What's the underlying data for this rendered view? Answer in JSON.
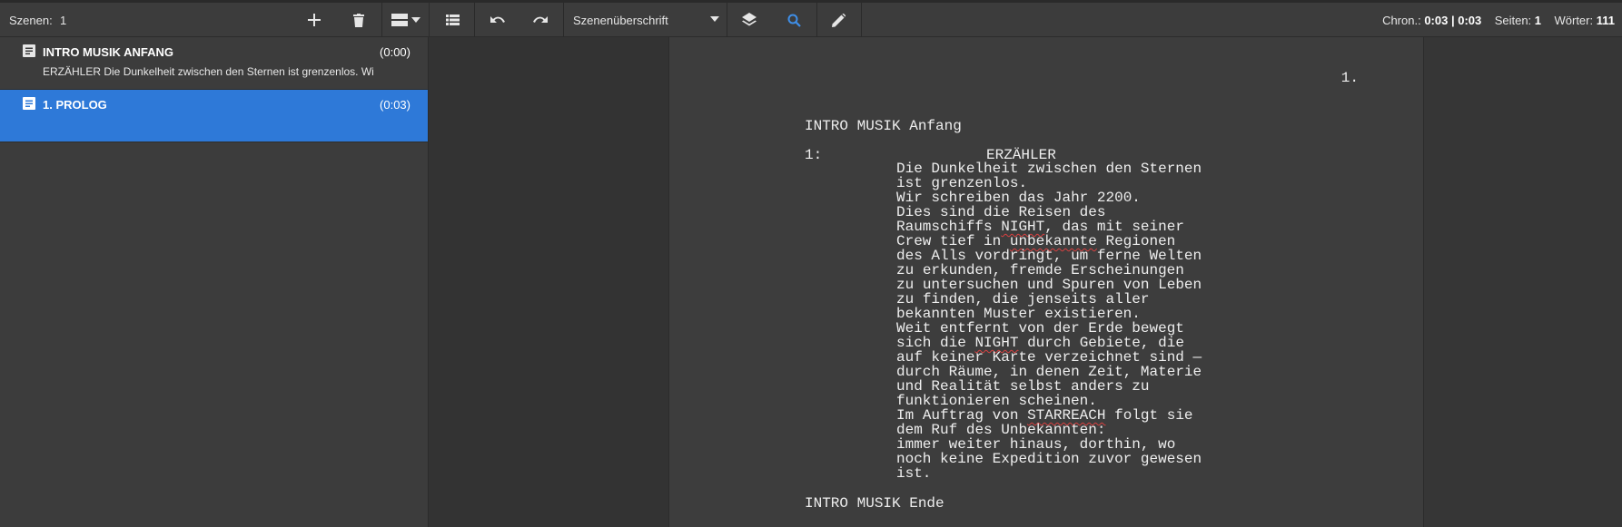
{
  "toolbar": {
    "scenes_label": "Szenen:",
    "scenes_count": "1",
    "add_icon": "plus-icon",
    "delete_icon": "trash-icon",
    "view_icon": "view-split-icon",
    "list_icon": "list-icon",
    "undo_icon": "undo-icon",
    "redo_icon": "redo-icon",
    "element_type": "Szenenüberschrift",
    "layers_icon": "layers-icon",
    "search_icon": "search-icon",
    "edit_icon": "pencil-icon",
    "stats": {
      "chron_label": "Chron.:",
      "chron_value": "0:03 | 0:03",
      "pages_label": "Seiten:",
      "pages_value": "1",
      "words_label": "Wörter:",
      "words_value": "111"
    }
  },
  "sidebar": {
    "scenes": [
      {
        "title": "INTRO MUSIK ANFANG",
        "time": "(0:00)",
        "description": "ERZÄHLER Die Dunkelheit zwischen den Sternen ist grenzenlos. Wir",
        "selected": false
      },
      {
        "title": "1. PROLOG",
        "time": "(0:03)",
        "description": "",
        "selected": true
      }
    ]
  },
  "script_page": {
    "page_number": "1.",
    "heading": "INTRO MUSIK Anfang",
    "line_number": "1:",
    "speaker": "ERZÄHLER",
    "dialog_lines": [
      "Die Dunkelheit zwischen den Sternen",
      "ist grenzenlos.",
      "Wir schreiben das Jahr 2200.",
      "Dies sind die Reisen des",
      "Raumschiffs NIGHT, das mit seiner",
      "Crew tief in unbekannte Regionen",
      "des Alls vordringt, um ferne Welten",
      "zu erkunden, fremde Erscheinungen",
      "zu untersuchen und Spuren von Leben",
      "zu finden, die jenseits aller",
      "bekannten Muster existieren.",
      "Weit entfernt von der Erde bewegt",
      "sich die NIGHT durch Gebiete, die",
      "auf keiner Karte verzeichnet sind —",
      "durch Räume, in denen Zeit, Materie",
      "und Realität selbst anders zu",
      "funktionieren scheinen.",
      "Im Auftrag von STARREACH folgt sie",
      "dem Ruf des Unbekannten:",
      "immer weiter hinaus, dorthin, wo",
      "noch keine Expedition zuvor gewesen",
      "ist."
    ],
    "spell_marked_words": [
      "NIGHT",
      "unbekannte",
      "STARREACH"
    ],
    "heading_end": "INTRO MUSIK Ende"
  },
  "colors": {
    "toolbar_bg": "#3c3c3c",
    "selected_bg": "#2e79d8",
    "search_icon": "#3f8fe8",
    "page_bg": "#3d3d3d"
  }
}
